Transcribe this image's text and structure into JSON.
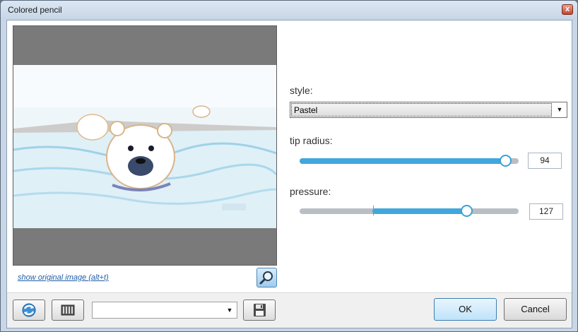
{
  "window": {
    "title": "Colored pencil",
    "close_label": "x"
  },
  "preview": {
    "show_original_link": "show original image (alt+t)"
  },
  "controls": {
    "style": {
      "label": "style:",
      "selected": "Pastel"
    },
    "tip_radius": {
      "label": "tip radius:",
      "value": "94",
      "fraction": 0.94
    },
    "pressure": {
      "label": "pressure:",
      "value": "127",
      "fraction": 0.76
    }
  },
  "footer": {
    "preset_value": "",
    "ok_label": "OK",
    "cancel_label": "Cancel"
  },
  "colors": {
    "accent": "#41a7dc",
    "window_frame": "#c9d6e5"
  }
}
